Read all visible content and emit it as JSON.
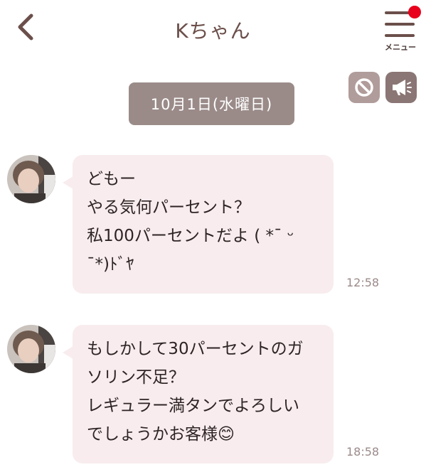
{
  "header": {
    "title": "Kちゃん",
    "menu_label": "メニュー",
    "menu_has_notification": true
  },
  "actions": {
    "block_icon": "block-icon",
    "announce_icon": "megaphone-icon"
  },
  "date_divider": "10月1日(水曜日)",
  "messages": [
    {
      "lines": [
        "どもー",
        "やる気何パーセント？",
        "私100パーセントだよ ( *¯ ᵕ",
        "¯*)ﾄﾞﾔ"
      ],
      "time": "12:58"
    },
    {
      "lines": [
        "もしかして30パーセントのガ",
        "ソリン不足？",
        "レギュラー満タンでよろしい",
        "でしょうかお客様😊"
      ],
      "time": "18:58"
    }
  ],
  "colors": {
    "header_text": "#6b4f4a",
    "bubble_bg": "#f8ecee",
    "date_pill_bg": "#9a8b89",
    "notification_dot": "#e8001c",
    "block_button_bg": "#b09c9a",
    "announce_button_bg": "#8a7674"
  }
}
